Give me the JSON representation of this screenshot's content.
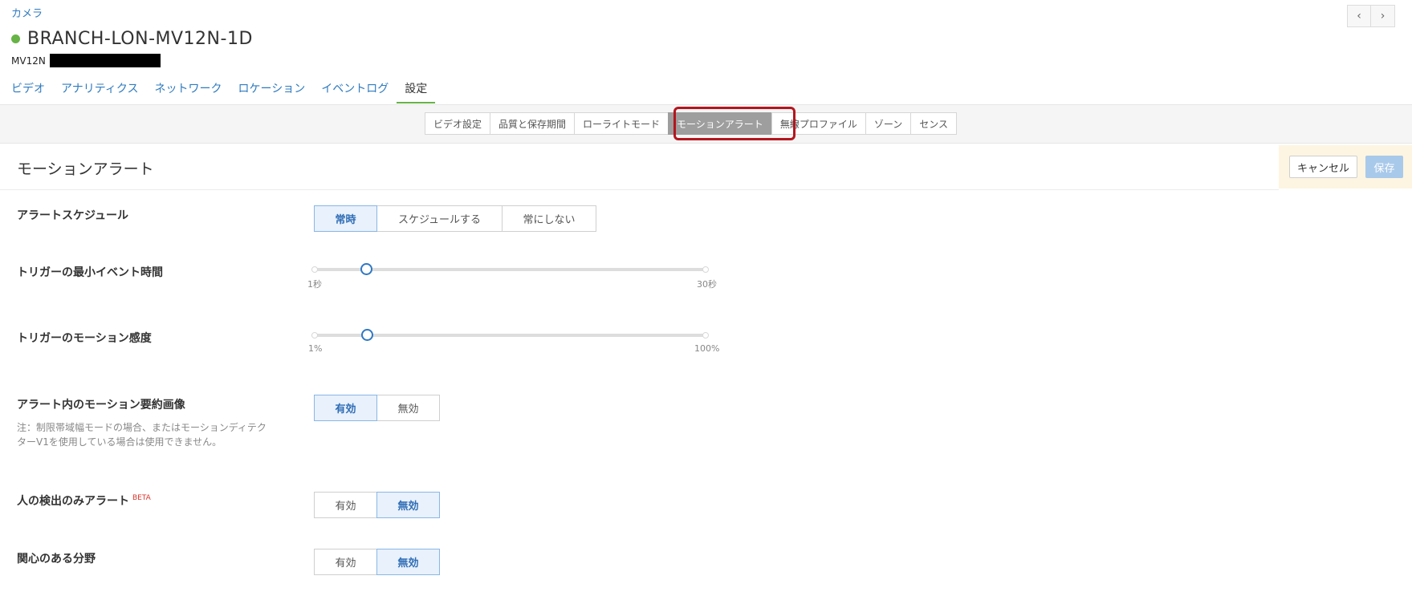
{
  "breadcrumb": "カメラ",
  "nav": {
    "prev_icon": "‹",
    "next_icon": "›"
  },
  "device": {
    "name": "BRANCH-LON-MV12N-1D",
    "status_color": "#67b346",
    "model": "MV12N"
  },
  "top_tabs": [
    "ビデオ",
    "アナリティクス",
    "ネットワーク",
    "ロケーション",
    "イベントログ",
    "設定"
  ],
  "top_tabs_active": "設定",
  "sub_tabs": [
    "ビデオ設定",
    "品質と保存期間",
    "ローライトモード",
    "モーションアラート",
    "無線プロファイル",
    "ゾーン",
    "センス"
  ],
  "sub_tabs_active": "モーションアラート",
  "section": {
    "title": "モーションアラート",
    "cancel_label": "キャンセル",
    "save_label": "保存"
  },
  "alert_schedule": {
    "label": "アラートスケジュール",
    "options": [
      "常時",
      "スケジュールする",
      "常にしない"
    ],
    "selected": "常時"
  },
  "min_event_time": {
    "label": "トリガーの最小イベント時間",
    "min_label": "1秒",
    "max_label": "30秒",
    "min": 1,
    "max": 30,
    "value": 5
  },
  "motion_sensitivity": {
    "label": "トリガーのモーション感度",
    "min_label": "1%",
    "max_label": "100%",
    "min": 1,
    "max": 100,
    "value": 15
  },
  "summary_image": {
    "label": "アラート内のモーション要約画像",
    "note": "注：制限帯域幅モードの場合、またはモーションディテクターV1を使用している場合は使用できません。",
    "options": [
      "有効",
      "無効"
    ],
    "selected": "有効"
  },
  "person_only": {
    "label": "人の検出のみアラート",
    "badge": "BETA",
    "options": [
      "有効",
      "無効"
    ],
    "selected": "無効"
  },
  "area_of_interest": {
    "label": "関心のある分野",
    "options": [
      "有効",
      "無効"
    ],
    "selected": "無効"
  }
}
